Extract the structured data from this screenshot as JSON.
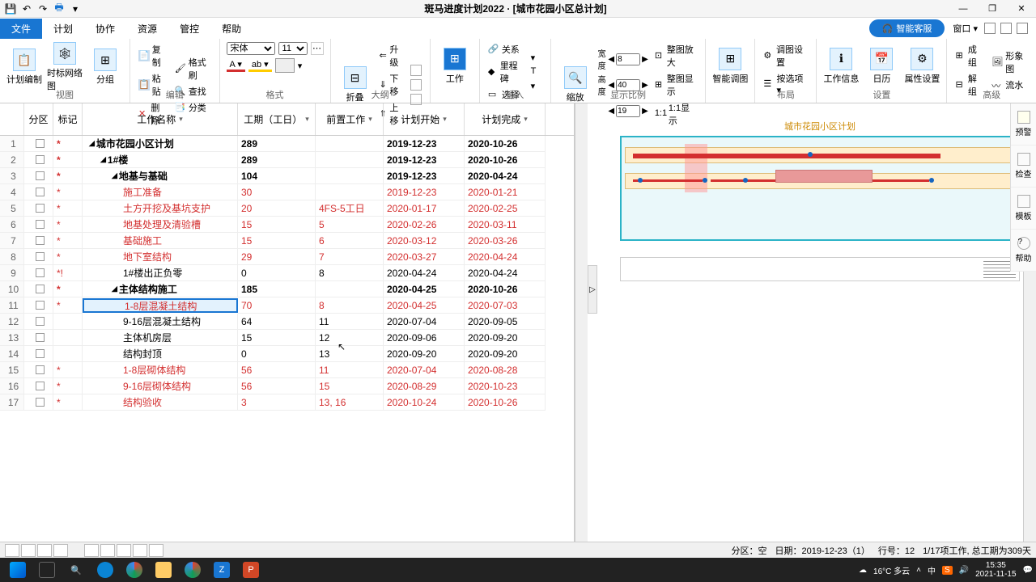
{
  "titlebar": {
    "title": "斑马进度计划2022 · [城市花园小区总计划]"
  },
  "menu": {
    "tabs": [
      "文件",
      "计划",
      "协作",
      "资源",
      "管控",
      "帮助"
    ],
    "active": 0,
    "kefu": "智能客服",
    "window": "窗口 ▾"
  },
  "ribbon": {
    "groups": {
      "view": {
        "label": "视图",
        "items": [
          "计划编制",
          "时标网络图",
          "分组"
        ]
      },
      "edit": {
        "label": "编辑",
        "items": [
          "复制",
          "格式刷",
          "粘贴",
          "查找",
          "删除",
          "分类"
        ]
      },
      "format": {
        "label": "格式",
        "font": "宋体",
        "size": "11"
      },
      "outline": {
        "label": "大纲",
        "btn": "折叠",
        "items": [
          "升级",
          "下移",
          "上移"
        ]
      },
      "work": {
        "label": "工作"
      },
      "insert": {
        "label": "插入",
        "items": [
          "关系",
          "里程碑",
          "选择"
        ]
      },
      "zoom": {
        "label": "显示比例",
        "btn": "缩放",
        "w": "宽度",
        "h": "高度",
        "vals": [
          "8",
          "40",
          "19"
        ],
        "items": [
          "整图放大",
          "整图显示",
          "1:1显示"
        ]
      },
      "smart": {
        "label": "",
        "btn": "智能调图"
      },
      "layout": {
        "label": "布局",
        "items": [
          "调图设置",
          "按选项 ▾"
        ]
      },
      "set": {
        "label": "设置",
        "items": [
          "工作信息",
          "日历",
          "属性设置"
        ]
      },
      "adv": {
        "label": "高级",
        "items": [
          "成组",
          "解组",
          "形象图",
          "流水"
        ]
      }
    }
  },
  "table": {
    "cols": [
      "分区",
      "标记",
      "工作名称",
      "工期（工日）",
      "前置工作",
      "计划开始",
      "计划完成"
    ],
    "rows": [
      {
        "n": 1,
        "m": "*",
        "name": "城市花园小区计划",
        "ind": 0,
        "ex": 1,
        "d": "289",
        "p": "",
        "s": "2019-12-23",
        "e": "2020-10-26",
        "cls": "black"
      },
      {
        "n": 2,
        "m": "*",
        "name": "1#楼",
        "ind": 1,
        "ex": 1,
        "d": "289",
        "p": "",
        "s": "2019-12-23",
        "e": "2020-10-26",
        "cls": "black"
      },
      {
        "n": 3,
        "m": "*",
        "name": "地基与基础",
        "ind": 2,
        "ex": 1,
        "d": "104",
        "p": "",
        "s": "2019-12-23",
        "e": "2020-04-24",
        "cls": "black"
      },
      {
        "n": 4,
        "m": "*",
        "name": "施工准备",
        "ind": 3,
        "ex": 0,
        "d": "30",
        "p": "",
        "s": "2019-12-23",
        "e": "2020-01-21",
        "cls": "red"
      },
      {
        "n": 5,
        "m": "*",
        "name": "土方开挖及基坑支护",
        "ind": 3,
        "ex": 0,
        "d": "20",
        "p": "4FS-5工日",
        "s": "2020-01-17",
        "e": "2020-02-25",
        "cls": "red"
      },
      {
        "n": 6,
        "m": "*",
        "name": "地基处理及清验槽",
        "ind": 3,
        "ex": 0,
        "d": "15",
        "p": "5",
        "s": "2020-02-26",
        "e": "2020-03-11",
        "cls": "red"
      },
      {
        "n": 7,
        "m": "*",
        "name": "基础施工",
        "ind": 3,
        "ex": 0,
        "d": "15",
        "p": "6",
        "s": "2020-03-12",
        "e": "2020-03-26",
        "cls": "red"
      },
      {
        "n": 8,
        "m": "*",
        "name": "地下室结构",
        "ind": 3,
        "ex": 0,
        "d": "29",
        "p": "7",
        "s": "2020-03-27",
        "e": "2020-04-24",
        "cls": "red"
      },
      {
        "n": 9,
        "m": "*!",
        "name": "1#楼出正负零",
        "ind": 3,
        "ex": 0,
        "d": "0",
        "p": "8",
        "s": "2020-04-24",
        "e": "2020-04-24",
        "cls": "redmark"
      },
      {
        "n": 10,
        "m": "*",
        "name": "主体结构施工",
        "ind": 2,
        "ex": 1,
        "d": "185",
        "p": "",
        "s": "2020-04-25",
        "e": "2020-10-26",
        "cls": "black"
      },
      {
        "n": 11,
        "m": "*",
        "name": "1-8层混凝土结构",
        "ind": 3,
        "ex": 0,
        "d": "70",
        "p": "8",
        "s": "2020-04-25",
        "e": "2020-07-03",
        "cls": "red",
        "sel": true
      },
      {
        "n": 12,
        "m": "",
        "name": "9-16层混凝土结构",
        "ind": 3,
        "ex": 0,
        "d": "64",
        "p": "11",
        "s": "2020-07-04",
        "e": "2020-09-05",
        "cls": "redmark"
      },
      {
        "n": 13,
        "m": "",
        "name": "主体机房层",
        "ind": 3,
        "ex": 0,
        "d": "15",
        "p": "12",
        "s": "2020-09-06",
        "e": "2020-09-20",
        "cls": "redmark"
      },
      {
        "n": 14,
        "m": "",
        "name": "结构封顶",
        "ind": 3,
        "ex": 0,
        "d": "0",
        "p": "13",
        "s": "2020-09-20",
        "e": "2020-09-20",
        "cls": "redmark"
      },
      {
        "n": 15,
        "m": "*",
        "name": "1-8层砌体结构",
        "ind": 3,
        "ex": 0,
        "d": "56",
        "p": "11",
        "s": "2020-07-04",
        "e": "2020-08-28",
        "cls": "red"
      },
      {
        "n": 16,
        "m": "*",
        "name": "9-16层砌体结构",
        "ind": 3,
        "ex": 0,
        "d": "56",
        "p": "15",
        "s": "2020-08-29",
        "e": "2020-10-23",
        "cls": "red"
      },
      {
        "n": 17,
        "m": "*",
        "name": "结构验收",
        "ind": 3,
        "ex": 0,
        "d": "3",
        "p": "13, 16",
        "s": "2020-10-24",
        "e": "2020-10-26",
        "cls": "red"
      }
    ]
  },
  "gantt": {
    "title": "城市花园小区计划"
  },
  "sidebar": [
    "预警",
    "检查",
    "模板",
    "帮助"
  ],
  "status": {
    "fenqu": "分区：空",
    "date": "日期：2019-12-23（1）",
    "row": "行号：12",
    "summary": "1/17项工作, 总工期为309天"
  },
  "taskbar": {
    "weather": "16°C 多云",
    "ime": "中",
    "time": "15:35",
    "date": "2021-11-15"
  }
}
